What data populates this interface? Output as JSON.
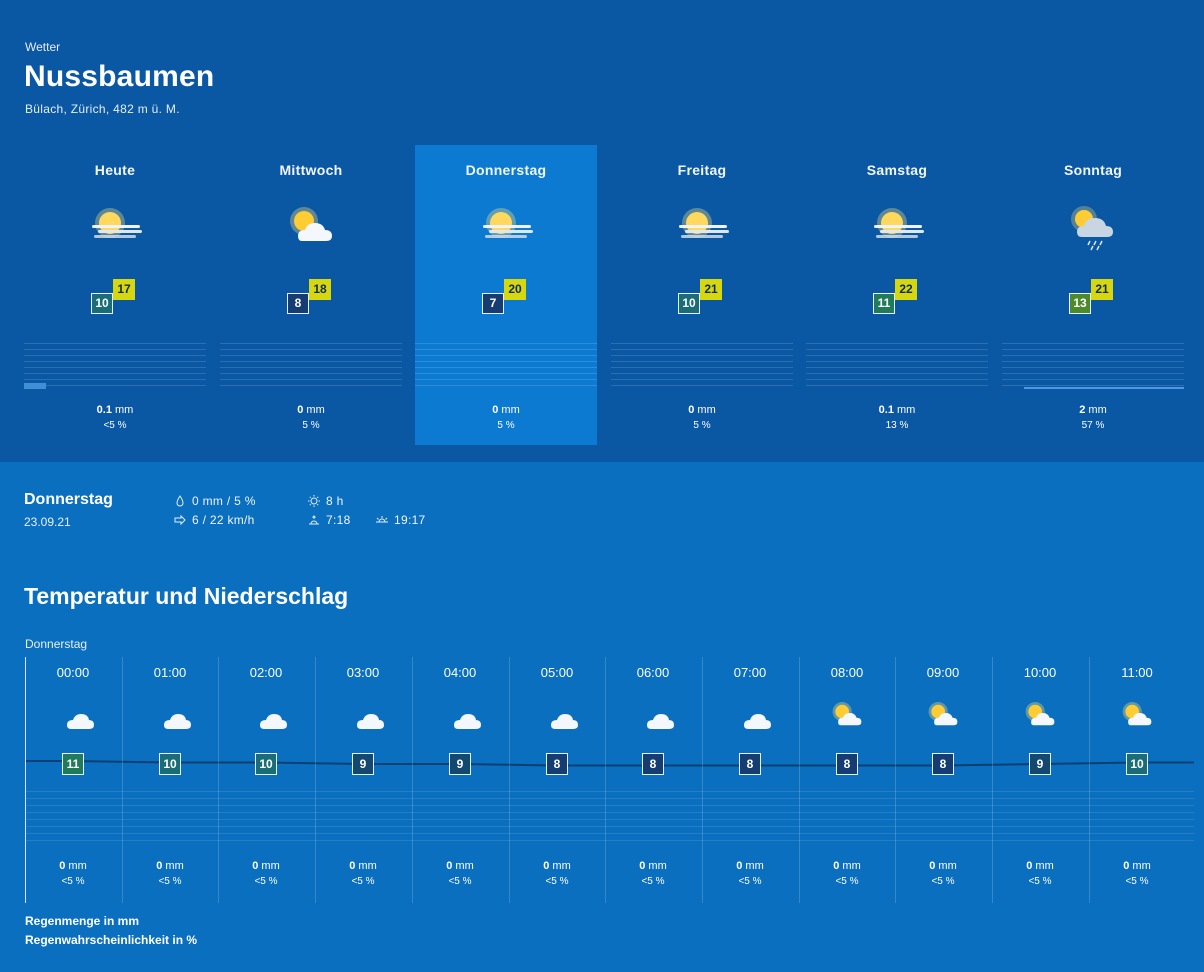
{
  "header": {
    "eyebrow": "Wetter",
    "city": "Nussbaumen",
    "location": "Bülach, Zürich, 482 m ü. M."
  },
  "days": [
    {
      "name": "Heute",
      "icon": "sun-behind-fog-icon",
      "min": "10",
      "max": "17",
      "min_color": "#1a6d76",
      "rain_mm": "0.1",
      "rain_prob": "<5 %",
      "rain_unit": "mm",
      "bar_fraction": 0.12,
      "selected": false
    },
    {
      "name": "Mittwoch",
      "icon": "sun-behind-cloud-icon",
      "min": "8",
      "max": "18",
      "min_color": "#163d72",
      "rain_mm": "0",
      "rain_prob": "5 %",
      "rain_unit": "mm",
      "bar_fraction": 0,
      "selected": false
    },
    {
      "name": "Donnerstag",
      "icon": "sun-behind-fog-icon",
      "min": "7",
      "max": "20",
      "min_color": "#163d72",
      "rain_mm": "0",
      "rain_prob": "5 %",
      "rain_unit": "mm",
      "bar_fraction": 0,
      "selected": true
    },
    {
      "name": "Freitag",
      "icon": "sun-behind-fog-icon",
      "min": "10",
      "max": "21",
      "min_color": "#1a6d76",
      "rain_mm": "0",
      "rain_prob": "5 %",
      "rain_unit": "mm",
      "bar_fraction": 0,
      "selected": false
    },
    {
      "name": "Samstag",
      "icon": "sun-behind-fog-icon",
      "min": "11",
      "max": "22",
      "min_color": "#1f7b5a",
      "rain_mm": "0.1",
      "rain_prob": "13 %",
      "rain_unit": "mm",
      "bar_fraction": 0,
      "selected": false
    },
    {
      "name": "Sonntag",
      "icon": "sun-cloud-rain-icon",
      "min": "13",
      "max": "21",
      "min_color": "#4d8a2c",
      "rain_mm": "2",
      "rain_prob": "57 %",
      "rain_unit": "mm",
      "bar_fraction": 0.25,
      "selected": false
    }
  ],
  "detail": {
    "day": "Donnerstag",
    "date": "23.09.21",
    "precip": "0 mm / 5 %",
    "wind": "6 / 22 km/h",
    "sunshine": "8 h",
    "sunrise": "7:18",
    "sunset": "19:17"
  },
  "hourly_section": {
    "title": "Temperatur und Niederschlag",
    "day": "Donnerstag",
    "legend_amount": "Regenmenge in mm",
    "legend_prob": "Regenwahrscheinlichkeit in %"
  },
  "hours": [
    {
      "time": "00:00",
      "icon": "moon-cloud-icon",
      "temp": "11",
      "color": "#1f7b5a",
      "rain_mm": "0",
      "rain_unit": "mm",
      "rain_prob": "<5 %"
    },
    {
      "time": "01:00",
      "icon": "moon-cloud-icon",
      "temp": "10",
      "color": "#1a6d76",
      "rain_mm": "0",
      "rain_unit": "mm",
      "rain_prob": "<5 %"
    },
    {
      "time": "02:00",
      "icon": "moon-cloud-icon",
      "temp": "10",
      "color": "#1a6d76",
      "rain_mm": "0",
      "rain_unit": "mm",
      "rain_prob": "<5 %"
    },
    {
      "time": "03:00",
      "icon": "moon-cloud-icon",
      "temp": "9",
      "color": "#13496f",
      "rain_mm": "0",
      "rain_unit": "mm",
      "rain_prob": "<5 %"
    },
    {
      "time": "04:00",
      "icon": "moon-cloud-icon",
      "temp": "9",
      "color": "#13496f",
      "rain_mm": "0",
      "rain_unit": "mm",
      "rain_prob": "<5 %"
    },
    {
      "time": "05:00",
      "icon": "moon-cloud-icon",
      "temp": "8",
      "color": "#163d72",
      "rain_mm": "0",
      "rain_unit": "mm",
      "rain_prob": "<5 %"
    },
    {
      "time": "06:00",
      "icon": "moon-cloud-icon",
      "temp": "8",
      "color": "#163d72",
      "rain_mm": "0",
      "rain_unit": "mm",
      "rain_prob": "<5 %"
    },
    {
      "time": "07:00",
      "icon": "moon-cloud-icon",
      "temp": "8",
      "color": "#163d72",
      "rain_mm": "0",
      "rain_unit": "mm",
      "rain_prob": "<5 %"
    },
    {
      "time": "08:00",
      "icon": "sun-cloud-icon",
      "temp": "8",
      "color": "#163d72",
      "rain_mm": "0",
      "rain_unit": "mm",
      "rain_prob": "<5 %"
    },
    {
      "time": "09:00",
      "icon": "sun-cloud-icon",
      "temp": "8",
      "color": "#163d72",
      "rain_mm": "0",
      "rain_unit": "mm",
      "rain_prob": "<5 %"
    },
    {
      "time": "10:00",
      "icon": "sun-cloud-icon",
      "temp": "9",
      "color": "#13496f",
      "rain_mm": "0",
      "rain_unit": "mm",
      "rain_prob": "<5 %"
    },
    {
      "time": "11:00",
      "icon": "sun-cloud-icon",
      "temp": "10",
      "color": "#1a6d76",
      "rain_mm": "0",
      "rain_unit": "mm",
      "rain_prob": "<5 %"
    }
  ],
  "colors": {
    "top_bg": "#0a57a3",
    "page_bg": "#0a6fbe",
    "selected_bg": "#0c7ad0",
    "max_temp_bg": "#d6d80d"
  }
}
